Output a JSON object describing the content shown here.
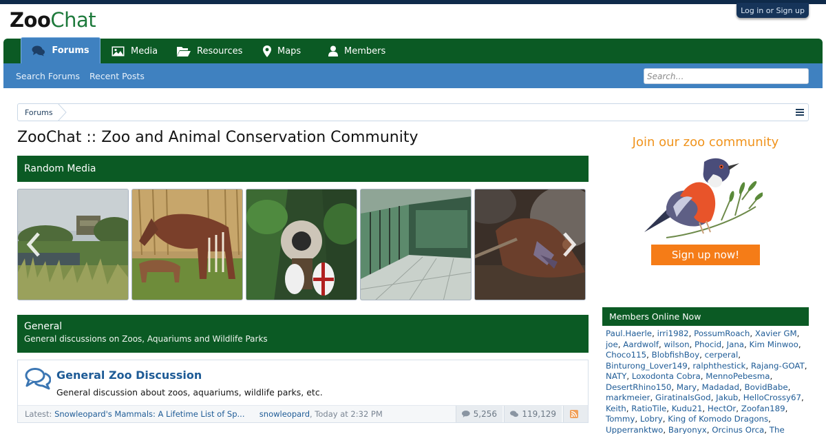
{
  "header": {
    "logo_zoo": "Zoo",
    "logo_chat": "Chat",
    "login_label": "Log in or Sign up"
  },
  "nav": {
    "items": [
      {
        "label": "Forums",
        "icon": "comments-icon",
        "active": true
      },
      {
        "label": "Media",
        "icon": "image-icon"
      },
      {
        "label": "Resources",
        "icon": "folder-open-icon"
      },
      {
        "label": "Maps",
        "icon": "map-marker-icon"
      },
      {
        "label": "Members",
        "icon": "user-icon"
      }
    ]
  },
  "subnav": {
    "links": [
      "Search Forums",
      "Recent Posts"
    ],
    "search_placeholder": "Search…"
  },
  "breadcrumb": {
    "items": [
      "Forums"
    ]
  },
  "page": {
    "title": "ZooChat :: Zoo and Animal Conservation Community"
  },
  "random_media": {
    "heading": "Random Media"
  },
  "category": {
    "title": "General",
    "description": "General discussions on Zoos, Aquariums and Wildlife Parks"
  },
  "forum": {
    "title": "General Zoo Discussion",
    "description": "General discussion about zoos, aquariums, wildlife parks, etc.",
    "latest_prefix": "Latest:",
    "latest_thread": "Snowleopard's Mammals: A Lifetime List of Sp...",
    "latest_user": "snowleopard",
    "latest_time": ", Today at 2:32 PM",
    "threads": "5,256",
    "messages": "119,129"
  },
  "promo": {
    "title": "Join our zoo community",
    "signup": "Sign up now!"
  },
  "members_online": {
    "heading": "Members Online Now",
    "names": [
      "Paul.Haerle",
      "irri1982",
      "PossumRoach",
      "Xavier GM",
      "joe",
      "Aardwolf",
      "wilson",
      "Phocid",
      "Jana",
      "Kim Minwoo",
      "Choco115",
      "BlobfishBoy",
      "cerperal",
      "Binturong_Lover149",
      "ralphthestick",
      "Rajang-GOAT",
      "NATY",
      "Loxodonta Cobra",
      "MennoPebesma",
      "DesertRhino150",
      "Mary",
      "Madadad",
      "BovidBabe",
      "markmeier",
      "GiratinaIsGod",
      "Jakub",
      "HelloCrossy67",
      "Keith",
      "RatioTile",
      "Kudu21",
      "HectOr",
      "Zoofan189",
      "Tommy",
      "Lobry",
      "King of Komodo Dragons",
      "Upperranktwo",
      "Baryonyx",
      "Orcinus Orca",
      "The Sleepy Hippo"
    ]
  },
  "colors": {
    "nav_green": "#0b5a24",
    "nav_blue": "#3f81c0",
    "link_blue": "#1e5b96",
    "promo_orange": "#f57c17"
  }
}
